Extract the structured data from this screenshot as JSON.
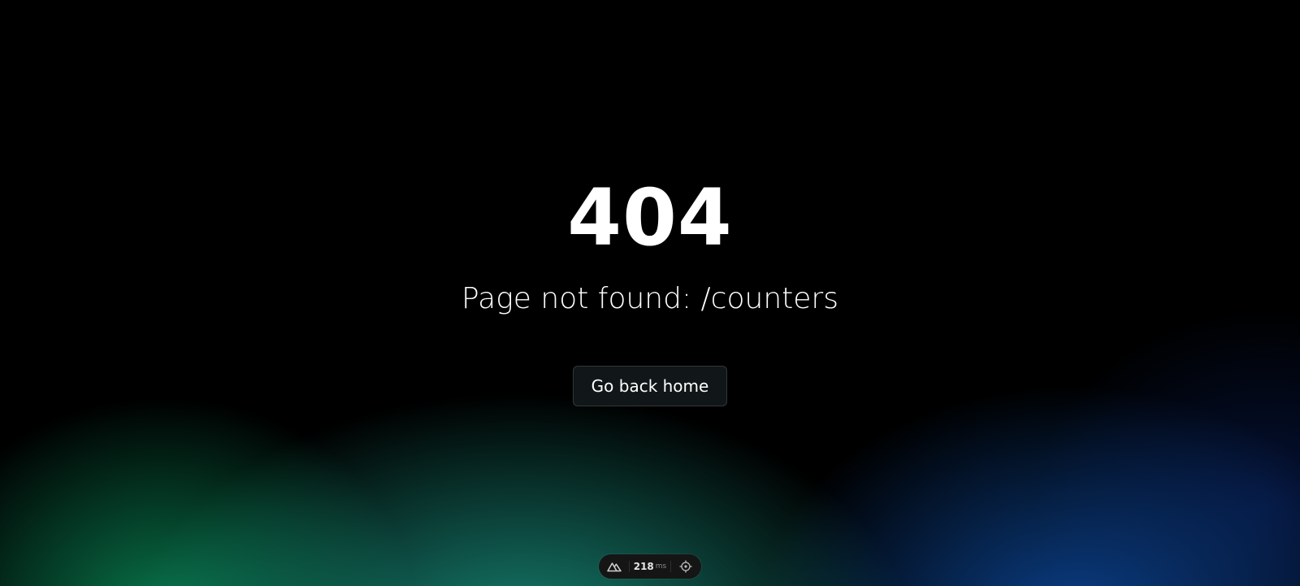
{
  "error": {
    "code": "404",
    "message": "Page not found: /counters"
  },
  "actions": {
    "home_label": "Go back home"
  },
  "devtools": {
    "logo_icon": "nuxt-logo-icon",
    "render_time_value": "218",
    "render_time_unit": "ms",
    "inspect_icon": "crosshair-icon"
  },
  "colors": {
    "background": "#000000",
    "glow_green": "#0a8c5a",
    "glow_teal": "#1ca08c",
    "glow_blue": "#0c4696",
    "text": "#ffffff"
  }
}
